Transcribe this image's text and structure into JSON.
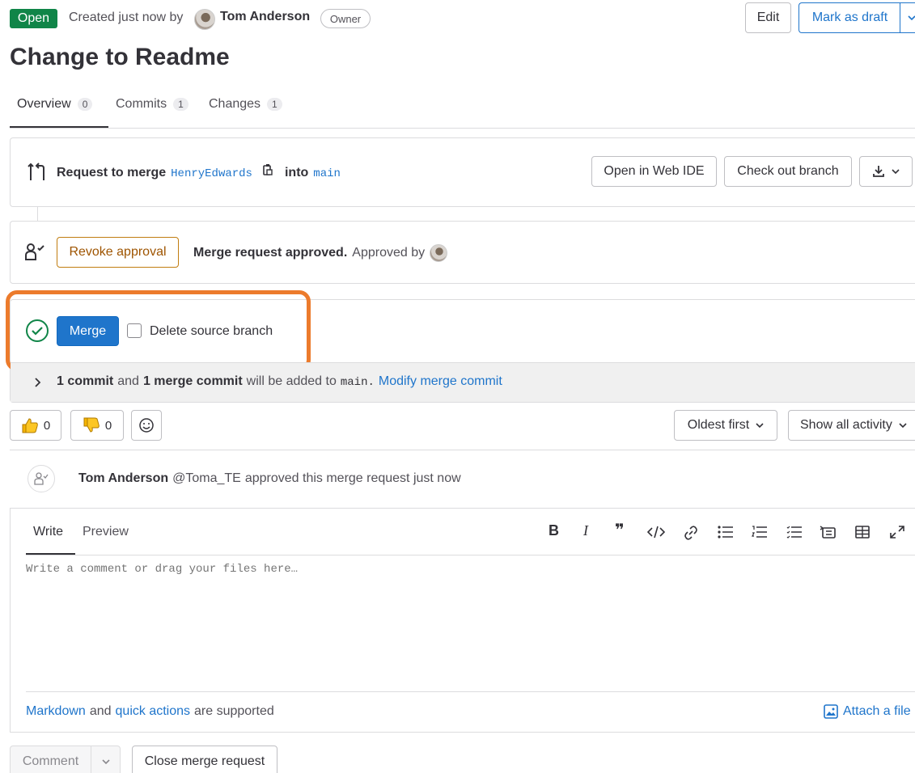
{
  "header": {
    "status_badge": "Open",
    "created_text": "Created just now by",
    "author": "Tom Anderson",
    "role_badge": "Owner",
    "edit_label": "Edit",
    "mark_draft_label": "Mark as draft",
    "title": "Change to Readme"
  },
  "tabs": [
    {
      "label": "Overview",
      "count": "0"
    },
    {
      "label": "Commits",
      "count": "1"
    },
    {
      "label": "Changes",
      "count": "1"
    }
  ],
  "merge_info": {
    "request_text": "Request to merge",
    "source_branch": "HenryEdwards",
    "into_text": "into",
    "target_branch": "main",
    "open_web_ide": "Open in Web IDE",
    "check_out_branch": "Check out branch"
  },
  "approval": {
    "revoke_label": "Revoke approval",
    "approved_text": "Merge request approved.",
    "approved_by": "Approved by"
  },
  "merge_action": {
    "merge_label": "Merge",
    "delete_source_label": "Delete source branch",
    "highlight_color": "#ec7b2c"
  },
  "commit_info": {
    "commit_bold": "1 commit",
    "and_text": "and",
    "merge_commit_bold": "1 merge commit",
    "will_be_added": "will be added to",
    "branch": "main.",
    "modify_link": "Modify merge commit"
  },
  "reactions": {
    "thumbs_up_count": "0",
    "thumbs_down_count": "0",
    "sort_label": "Oldest first",
    "filter_label": "Show all activity"
  },
  "activity": {
    "user": "Tom Anderson",
    "handle": "@Toma_TE",
    "action": "approved this merge request just now"
  },
  "editor": {
    "write_tab": "Write",
    "preview_tab": "Preview",
    "placeholder": "Write a comment or drag your files here…",
    "markdown_link": "Markdown",
    "and_text": "and",
    "quick_actions_link": "quick actions",
    "supported_text": "are supported",
    "attach_label": "Attach a file"
  },
  "footer": {
    "comment_label": "Comment",
    "close_label": "Close merge request"
  },
  "colors": {
    "open_green": "#108548",
    "brand_blue": "#1f75cb",
    "success_green": "#108548",
    "revoke_orange": "#c17d10"
  }
}
